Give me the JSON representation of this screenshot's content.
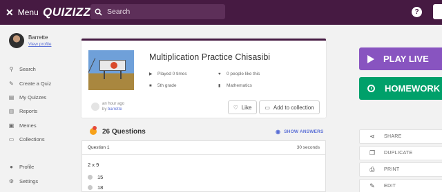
{
  "topbar": {
    "menu_label": "Menu",
    "logo": "QUIZIZZ",
    "search_placeholder": "Search",
    "help_label": "?"
  },
  "sidebar": {
    "user_name": "Barrette",
    "view_profile": "View profile",
    "nav": [
      {
        "label": "Search",
        "icon": "search-icon"
      },
      {
        "label": "Create a Quiz",
        "icon": "create-icon"
      },
      {
        "label": "My Quizzes",
        "icon": "quizzes-icon"
      },
      {
        "label": "Reports",
        "icon": "reports-icon"
      },
      {
        "label": "Memes",
        "icon": "memes-icon"
      },
      {
        "label": "Collections",
        "icon": "folder-icon"
      },
      {
        "label": "Profile",
        "icon": "person-icon"
      },
      {
        "label": "Settings",
        "icon": "gear-icon"
      }
    ]
  },
  "quiz": {
    "title": "Multiplication Practice Chisasibi",
    "played": "Played 0 times",
    "likes": "0 people like this",
    "grade": "5th grade",
    "subject": "Mathematics",
    "created": "an hour ago",
    "by_prefix": "by",
    "author": "barrette",
    "like_label": "Like",
    "add_collection_label": "Add to collection"
  },
  "questions": {
    "count_label": "26 Questions",
    "show_answers": "SHOW ANSWERS",
    "first": {
      "label": "Question 1",
      "time": "30 seconds",
      "text": "2 x 9",
      "options": [
        "15",
        "18"
      ]
    }
  },
  "actions": {
    "play_live": "PLAY LIVE",
    "homework": "HOMEWORK",
    "share": "SHARE",
    "duplicate": "DUPLICATE",
    "print": "PRINT",
    "edit": "EDIT"
  },
  "colors": {
    "topbar": "#461a42",
    "play_live": "#8854c0",
    "homework": "#00a06a",
    "link": "#5a6fd6"
  }
}
